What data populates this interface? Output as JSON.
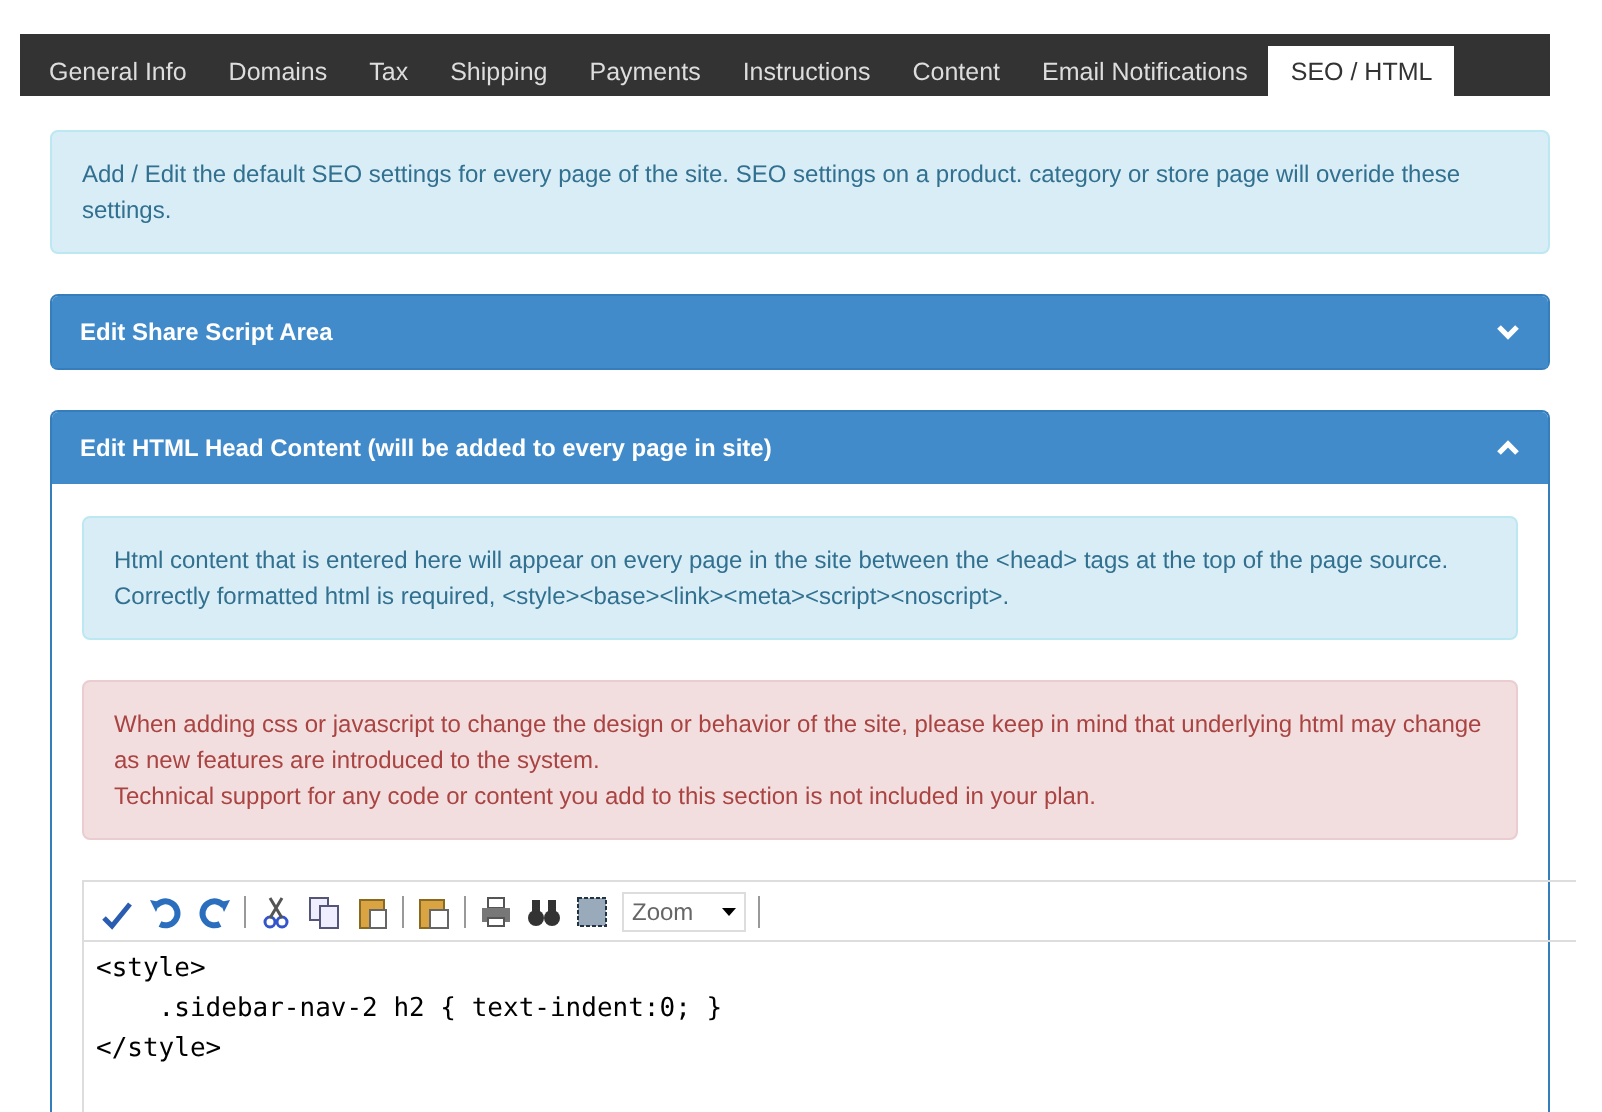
{
  "tabs": [
    {
      "label": "General Info",
      "selected": false
    },
    {
      "label": "Domains",
      "selected": false
    },
    {
      "label": "Tax",
      "selected": false
    },
    {
      "label": "Shipping",
      "selected": false
    },
    {
      "label": "Payments",
      "selected": false
    },
    {
      "label": "Instructions",
      "selected": false
    },
    {
      "label": "Content",
      "selected": false
    },
    {
      "label": "Email Notifications",
      "selected": false
    },
    {
      "label": "SEO / HTML",
      "selected": true
    }
  ],
  "intro": "Add / Edit the default SEO settings for every page of the site. SEO settings on a product. category or store page will overide these settings.",
  "panels": [
    {
      "title": "Edit Share Script Area",
      "expanded": false
    },
    {
      "title": "Edit HTML Head Content (will be added to every page in site)",
      "expanded": true,
      "alerts": [
        {
          "kind": "info",
          "lines": [
            "Html content that is entered here will appear on every page in the site between the <head> tags at the top of the page source.",
            "Correctly formatted html is required, <style><base><link><meta><script><noscript>."
          ]
        },
        {
          "kind": "danger",
          "lines": [
            "When adding css or javascript to change the design or behavior of the site, please keep in mind that underlying html may change as new features are introduced to the system.",
            "Technical support for any code or content you add to this section is not included in your plan."
          ]
        }
      ],
      "editor": {
        "zoom": "Zoom",
        "code": [
          "<style>",
          "    .sidebar-nav-2 h2 { text-indent:0; }",
          "</style>"
        ]
      }
    }
  ]
}
